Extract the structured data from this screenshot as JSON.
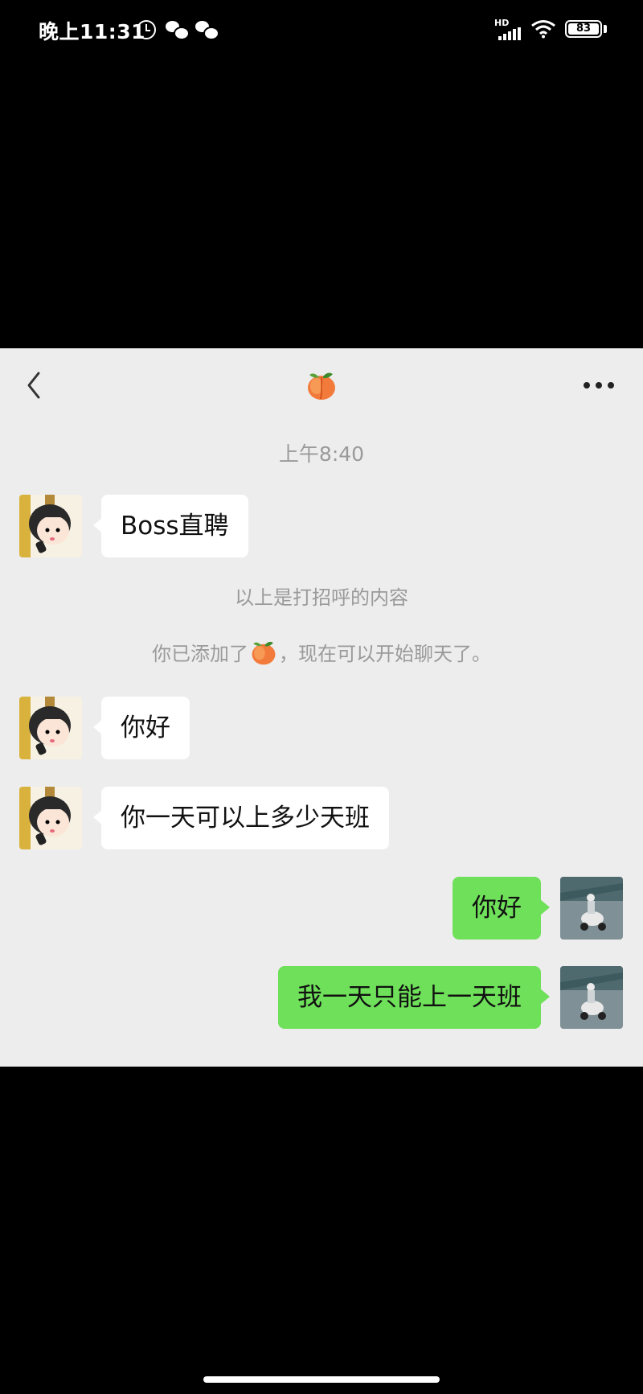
{
  "status_bar": {
    "time": "晚上11:31",
    "network_label": "HD",
    "battery": "83"
  },
  "chat": {
    "title_icon": "peach-emoji",
    "timestamp": "上午8:40",
    "greeting_notice": "以上是打招呼的内容",
    "added_notice_prefix": "你已添加了",
    "added_notice_suffix": "，现在可以开始聊天了。",
    "messages": [
      {
        "side": "left",
        "text": "Boss直聘"
      },
      {
        "side": "left",
        "text": "你好"
      },
      {
        "side": "left",
        "text": "你一天可以上多少天班"
      },
      {
        "side": "right",
        "text": "你好"
      },
      {
        "side": "right",
        "text": "我一天只能上一天班"
      }
    ]
  },
  "colors": {
    "chat_background": "#ededed",
    "outgoing_bubble": "#6fe05a",
    "incoming_bubble": "#ffffff"
  }
}
